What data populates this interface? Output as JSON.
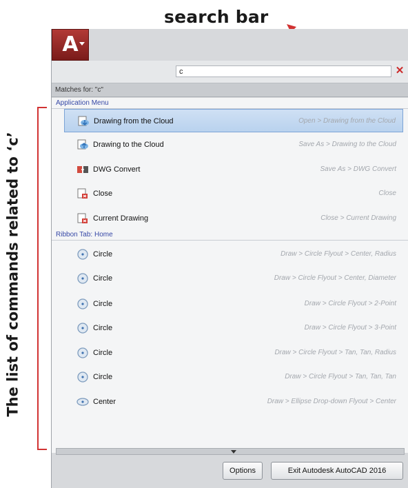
{
  "annotations": {
    "top_label": "search bar",
    "side_label": "The list of commands related to ‘c’",
    "arrow_color": "#d13232"
  },
  "app": {
    "button_letter": "A",
    "search": {
      "value": "c",
      "placeholder": ""
    },
    "matches_label": "Matches for: \"c\"",
    "groups": [
      {
        "header": "Application Menu",
        "items": [
          {
            "name": "Drawing from the Cloud",
            "path": "Open > Drawing from the Cloud",
            "icon": "cloud-download-icon",
            "selected": true
          },
          {
            "name": "Drawing to the Cloud",
            "path": "Save As > Drawing to the Cloud",
            "icon": "cloud-upload-icon",
            "selected": false
          },
          {
            "name": "DWG Convert",
            "path": "Save As > DWG Convert",
            "icon": "dwg-convert-icon",
            "selected": false
          },
          {
            "name": "Close",
            "path": "Close",
            "icon": "close-file-icon",
            "selected": false
          },
          {
            "name": "Current Drawing",
            "path": "Close > Current Drawing",
            "icon": "close-file-icon",
            "selected": false
          }
        ]
      },
      {
        "header": "Ribbon Tab: Home",
        "items": [
          {
            "name": "Circle",
            "path": "Draw > Circle Flyout > Center, Radius",
            "icon": "circle-center-radius-icon"
          },
          {
            "name": "Circle",
            "path": "Draw > Circle Flyout > Center, Diameter",
            "icon": "circle-center-diameter-icon"
          },
          {
            "name": "Circle",
            "path": "Draw > Circle Flyout > 2-Point",
            "icon": "circle-2-point-icon"
          },
          {
            "name": "Circle",
            "path": "Draw > Circle Flyout > 3-Point",
            "icon": "circle-3-point-icon"
          },
          {
            "name": "Circle",
            "path": "Draw > Circle Flyout > Tan, Tan, Radius",
            "icon": "circle-tan-tan-radius-icon"
          },
          {
            "name": "Circle",
            "path": "Draw > Circle Flyout > Tan, Tan, Tan",
            "icon": "circle-tan-tan-tan-icon"
          },
          {
            "name": "Center",
            "path": "Draw > Ellipse Drop-down Flyout > Center",
            "icon": "ellipse-center-icon"
          }
        ]
      }
    ],
    "options_label": "Options",
    "exit_label": "Exit Autodesk AutoCAD 2016"
  }
}
